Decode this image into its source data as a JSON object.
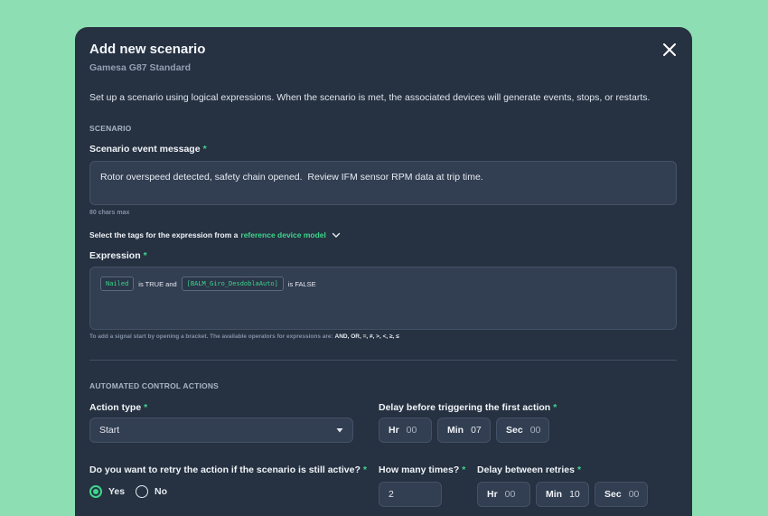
{
  "modal": {
    "title": "Add new scenario",
    "subtitle": "Gamesa G87 Standard",
    "description": "Set up a scenario using logical expressions. When the scenario is met, the associated devices will generate events, stops, or restarts."
  },
  "scenario": {
    "section_title": "SCENARIO",
    "message_label": "Scenario event message",
    "message_value": "Rotor overspeed detected, safety chain opened.  Review IFM sensor RPM data at trip time.",
    "message_hint": "80 chars max",
    "tag_select_prefix": "Select the tags for the expression from a",
    "tag_select_link": "reference device model",
    "expression_label": "Expression",
    "expression": {
      "tag1": "Nailed",
      "text1": "is TRUE and",
      "tag2": "[BALM_Giro_DesdoblaAuto]",
      "text2": "is FALSE"
    },
    "operators_hint_prefix": "To add a signal start by opening a bracket. The available operators for expressions are:",
    "operators": "AND, OR, =, ≠, >, <, ≥, ≤"
  },
  "actions": {
    "section_title": "AUTOMATED CONTROL ACTIONS",
    "action_type_label": "Action type",
    "action_type_value": "Start",
    "delay_label": "Delay before triggering the first action",
    "delay": {
      "hr_label": "Hr",
      "hr": "00",
      "min_label": "Min",
      "min": "07",
      "sec_label": "Sec",
      "sec": "00"
    },
    "retry_label": "Do you want to retry the action if the scenario is still active?",
    "retry_yes": "Yes",
    "retry_no": "No",
    "retry_selected": "yes",
    "times_label": "How many times?",
    "times_value": "2",
    "retry_delay_label": "Delay between retries",
    "retry_delay": {
      "hr_label": "Hr",
      "hr": "00",
      "min_label": "Min",
      "min": "10",
      "sec_label": "Sec",
      "sec": "00"
    }
  },
  "colors": {
    "accent": "#3dd68c",
    "background": "#8ddfb3",
    "panel": "#263141"
  },
  "icons": {
    "close": "close-icon",
    "chevron": "chevron-down-icon",
    "caret": "caret-down-icon"
  }
}
